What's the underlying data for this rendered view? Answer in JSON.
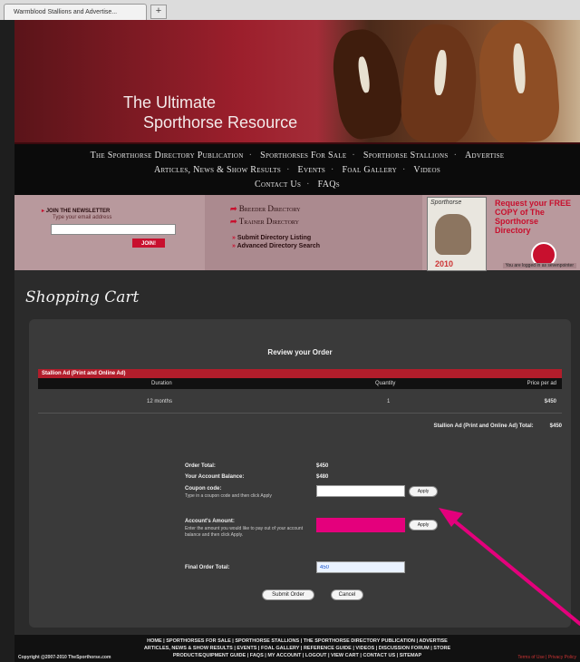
{
  "browser": {
    "tab_title": "Warmblood Stallions and Advertise..."
  },
  "banner": {
    "tagline_line1": "The Ultimate",
    "tagline_line2": "Sporthorse Resource"
  },
  "nav": {
    "row1": [
      "The Sporthorse Directory Publication",
      "Sporthorses For Sale",
      "Sporthorse Stallions",
      "Advertise"
    ],
    "row2": [
      "Articles, News & Show Results",
      "Events",
      "Foal Gallery",
      "Videos"
    ],
    "row3": [
      "Contact Us",
      "FAQs"
    ]
  },
  "newsletter": {
    "label": "JOIN THE NEWSLETTER",
    "hint": "Type your email address",
    "button": "JOIN!"
  },
  "directories": {
    "breeder": "Breeder Directory",
    "trainer": "Trainer Directory",
    "submit": "Submit Directory Listing",
    "search": "Advanced Directory Search"
  },
  "promo": {
    "magazine_title": "Sporthorse",
    "year": "2010",
    "request_text": "Request your FREE COPY of The Sporthorse Directory",
    "logged_in": "You are logged in as sevenpointer"
  },
  "page": {
    "heading": "Shopping Cart",
    "review_title": "Review your Order",
    "product_name": "Stallion Ad (Print and Online Ad)",
    "columns": {
      "duration": "Duration",
      "quantity": "Quantity",
      "price": "Price per ad"
    },
    "row": {
      "duration": "12 months",
      "quantity": "1",
      "price": "$450"
    },
    "subtotal_label": "Stallion Ad (Print and Online Ad) Total:",
    "subtotal_value": "$450"
  },
  "form": {
    "order_total_label": "Order Total:",
    "order_total_value": "$450",
    "account_balance_label": "Your Account Balance:",
    "account_balance_value": "$480",
    "coupon_label": "Coupon code:",
    "coupon_hint": "Type in a coupon code and then click Apply",
    "account_amount_label": "Account's Amount:",
    "account_amount_hint": "Enter the amount you would like to pay out of your account balance and then click Apply.",
    "final_total_label": "Final Order Total:",
    "final_total_value": "450",
    "apply_label": "Apply",
    "submit_label": "Submit Order",
    "cancel_label": "Cancel"
  },
  "footer": {
    "line1": "HOME | SPORTHORSES FOR SALE | SPORTHORSE STALLIONS | THE SPORTHORSE DIRECTORY PUBLICATION | ADVERTISE",
    "line2": "ARTICLES, NEWS & SHOW RESULTS | EVENTS | FOAL GALLERY | REFERENCE GUIDE | VIDEOS | DISCUSSION FORUM | STORE",
    "line3": "PRODUCT/EQUIPMENT GUIDE | FAQS | MY ACCOUNT | LOGOUT | VIEW CART | CONTACT US | SITEMAP",
    "copyright": "Copyright @2007-2010 TheSporthorse.com",
    "terms": "Terms of Use | Privacy Policy"
  },
  "colors": {
    "accent": "#b21d2b",
    "annotation": "#e4007c",
    "background": "#2b2b2b"
  }
}
